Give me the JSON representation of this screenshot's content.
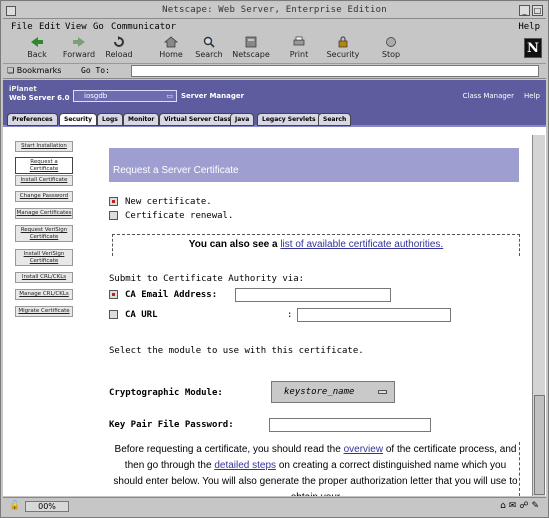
{
  "window": {
    "title": "Netscape: Web Server, Enterprise Edition"
  },
  "menu": {
    "file": "File",
    "edit": "Edit",
    "view": "View",
    "go": "Go",
    "communicator": "Communicator",
    "help": "Help"
  },
  "toolbar": {
    "back": "Back",
    "forward": "Forward",
    "reload": "Reload",
    "home": "Home",
    "search": "Search",
    "netscape": "Netscape",
    "print": "Print",
    "security": "Security",
    "stop": "Stop"
  },
  "location": {
    "bookmarks": "Bookmarks",
    "label": "Go To:",
    "value": ""
  },
  "header": {
    "product_line1": "iPlanet",
    "product_line2": "Web Server 6.0",
    "server_select": "iosgdb",
    "server_manager": "Server Manager",
    "class_manager": "Class Manager",
    "help": "Help"
  },
  "tabs": [
    "Preferences",
    "Security",
    "Logs",
    "Monitor",
    "Virtual Server Class",
    "Java",
    "Legacy Servlets",
    "Search"
  ],
  "leftnav": [
    "Start Installation",
    "Request a Certificate",
    "Install Certificate",
    "Change Password",
    "Manage Certificates",
    "Request VeriSign Certificate",
    "Install VeriSign Certificate",
    "Install CRL/CKLs",
    "Manage CRL/CKLs",
    "Migrate Certificate"
  ],
  "form": {
    "title": "Request a Server Certificate",
    "new_certificate": "New certificate.",
    "renewal": "Certificate renewal.",
    "ca_notice_prefix": "You can also see a ",
    "ca_notice_link": "list of available certificate authorities.",
    "submit_via": "Submit to Certificate Authority via:",
    "ca_email_label": "CA Email Address:",
    "ca_email_value": "",
    "ca_url_label": "CA URL",
    "ca_url_colon": ":",
    "ca_url_value": "",
    "module_prompt": "Select the module to use with this certificate.",
    "crypto_label": "Cryptographic Module:",
    "crypto_value": "keystore_name",
    "password_label": "Key Pair File Password:",
    "para_1": "Before requesting a certificate, you should read the ",
    "para_link1": "overview",
    "para_2": " of the certificate process, and then go through the ",
    "para_link2": "detailed steps",
    "para_3": " on creating a correct distinguished name which you should enter below. You will also generate the proper authorization letter that you will use to obtain your"
  },
  "status": {
    "progress": "00%"
  }
}
